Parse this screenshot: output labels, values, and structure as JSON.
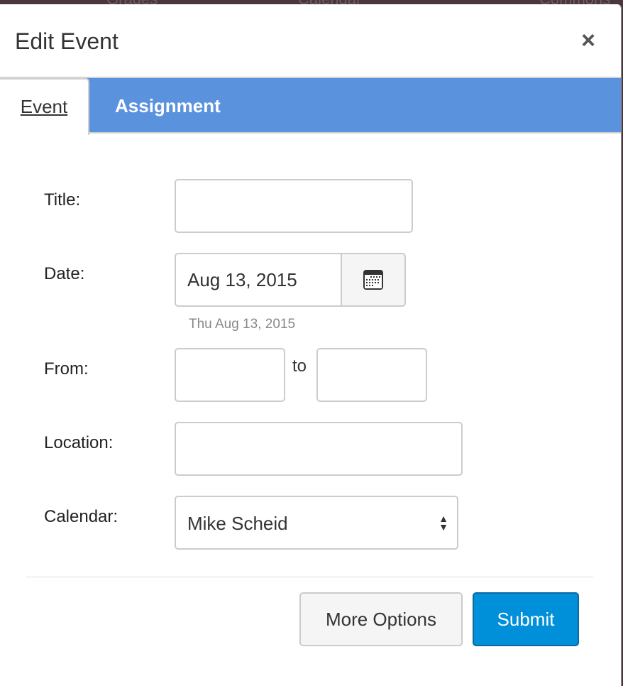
{
  "background_nav": [
    "Grades",
    "Calendar",
    "Commons"
  ],
  "modal": {
    "title": "Edit Event",
    "close_label": "×"
  },
  "tabs": [
    {
      "label": "Event",
      "active": true
    },
    {
      "label": "Assignment",
      "active": false
    }
  ],
  "form": {
    "title": {
      "label": "Title:",
      "value": ""
    },
    "date": {
      "label": "Date:",
      "value": "Aug 13, 2015",
      "hint": "Thu Aug 13, 2015",
      "icon": "calendar-icon"
    },
    "from": {
      "label": "From:",
      "start": "",
      "separator": "to",
      "end": ""
    },
    "location": {
      "label": "Location:",
      "value": ""
    },
    "calendar": {
      "label": "Calendar:",
      "value": "Mike Scheid"
    }
  },
  "buttons": {
    "more_options": "More Options",
    "submit": "Submit"
  },
  "colors": {
    "tab_bar": "#5a92de",
    "submit": "#0090d9"
  }
}
